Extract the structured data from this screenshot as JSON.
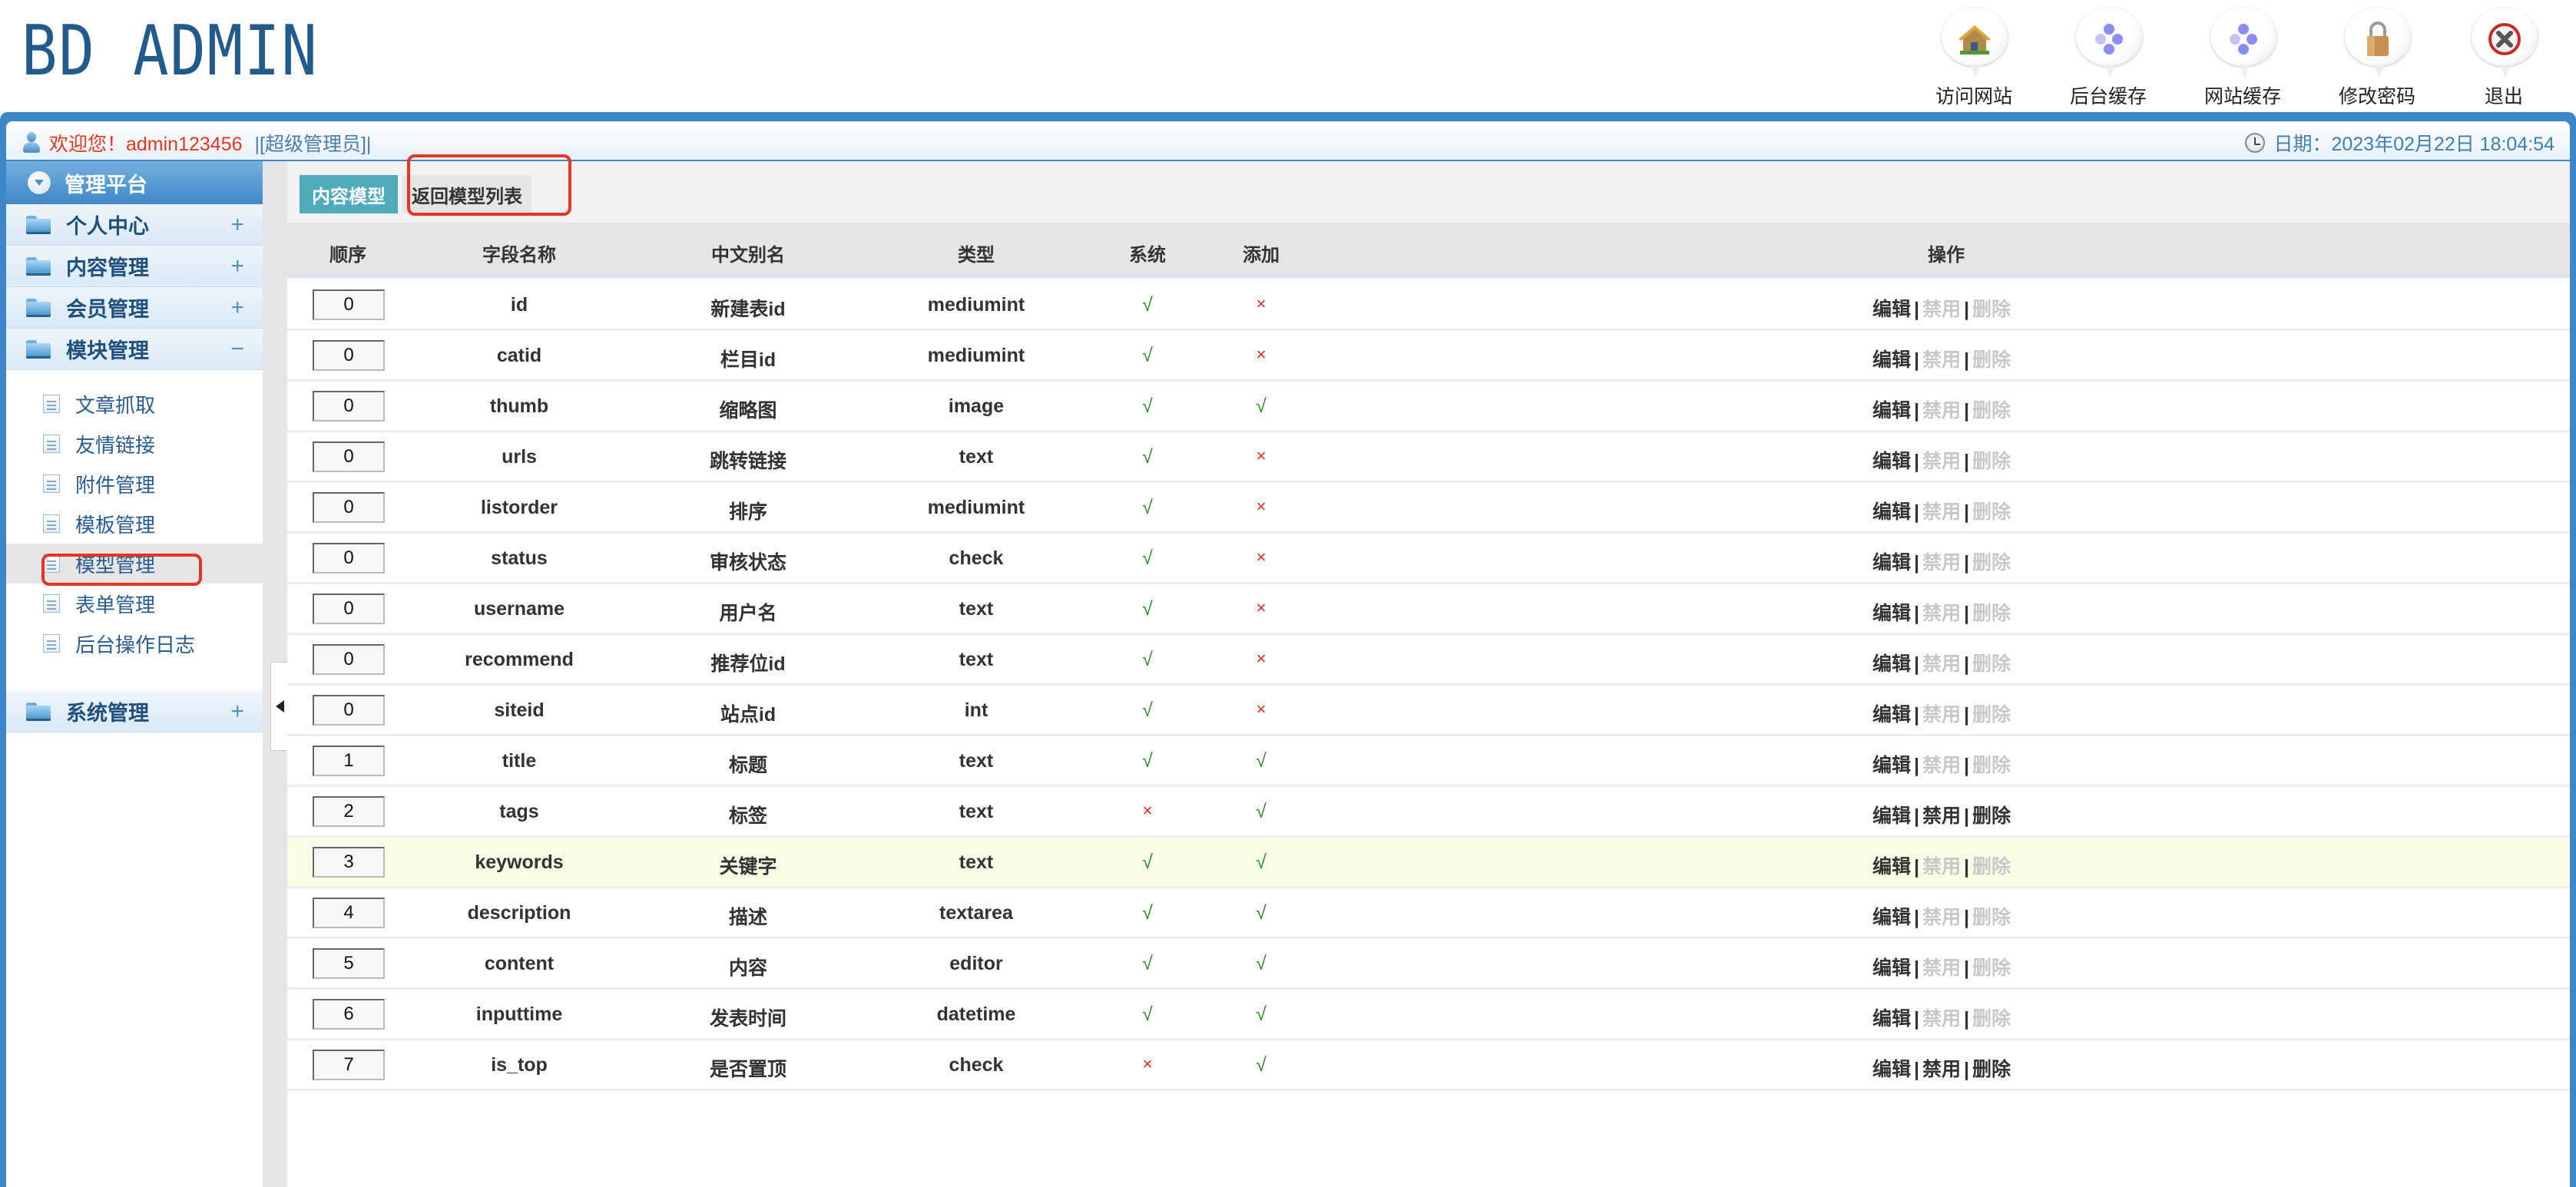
{
  "header": {
    "logo": "BD ADMIN",
    "tools": [
      {
        "label": "访问网站",
        "icon": "house-icon"
      },
      {
        "label": "后台缓存",
        "icon": "cache-icon"
      },
      {
        "label": "网站缓存",
        "icon": "cache-icon"
      },
      {
        "label": "修改密码",
        "icon": "padlock-icon"
      },
      {
        "label": "退出",
        "icon": "logout-icon"
      }
    ]
  },
  "welcome": {
    "greeting": "欢迎您！admin123456",
    "role": "|[超级管理员]|",
    "date": "日期：2023年02月22日 18:04:54"
  },
  "sidebar": {
    "title": "管理平台",
    "groups": [
      {
        "label": "个人中心",
        "toggle": "+"
      },
      {
        "label": "内容管理",
        "toggle": "+"
      },
      {
        "label": "会员管理",
        "toggle": "+"
      },
      {
        "label": "模块管理",
        "toggle": "−"
      },
      {
        "label": "系统管理",
        "toggle": "+"
      }
    ],
    "module_items": [
      {
        "label": "文章抓取"
      },
      {
        "label": "友情链接"
      },
      {
        "label": "附件管理"
      },
      {
        "label": "模板管理"
      },
      {
        "label": "模型管理",
        "active": true
      },
      {
        "label": "表单管理"
      },
      {
        "label": "后台操作日志"
      }
    ]
  },
  "tabs": {
    "current": "内容模型",
    "back": "返回模型列表"
  },
  "table": {
    "headers": [
      "顺序",
      "字段名称",
      "中文别名",
      "类型",
      "系统",
      "添加",
      "操作"
    ],
    "actions": {
      "edit": "编辑",
      "disable": "禁用",
      "delete": "删除",
      "sep": "|"
    },
    "marks": {
      "yes": "√",
      "no": "×"
    },
    "rows": [
      {
        "order": "0",
        "field": "id",
        "alias": "新建表id",
        "type": "mediumint",
        "system": true,
        "add": false,
        "ops_enabled": false
      },
      {
        "order": "0",
        "field": "catid",
        "alias": "栏目id",
        "type": "mediumint",
        "system": true,
        "add": false,
        "ops_enabled": false
      },
      {
        "order": "0",
        "field": "thumb",
        "alias": "缩略图",
        "type": "image",
        "system": true,
        "add": true,
        "ops_enabled": false
      },
      {
        "order": "0",
        "field": "urls",
        "alias": "跳转链接",
        "type": "text",
        "system": true,
        "add": false,
        "ops_enabled": false
      },
      {
        "order": "0",
        "field": "listorder",
        "alias": "排序",
        "type": "mediumint",
        "system": true,
        "add": false,
        "ops_enabled": false
      },
      {
        "order": "0",
        "field": "status",
        "alias": "审核状态",
        "type": "check",
        "system": true,
        "add": false,
        "ops_enabled": false
      },
      {
        "order": "0",
        "field": "username",
        "alias": "用户名",
        "type": "text",
        "system": true,
        "add": false,
        "ops_enabled": false
      },
      {
        "order": "0",
        "field": "recommend",
        "alias": "推荐位id",
        "type": "text",
        "system": true,
        "add": false,
        "ops_enabled": false
      },
      {
        "order": "0",
        "field": "siteid",
        "alias": "站点id",
        "type": "int",
        "system": true,
        "add": false,
        "ops_enabled": false
      },
      {
        "order": "1",
        "field": "title",
        "alias": "标题",
        "type": "text",
        "system": true,
        "add": true,
        "ops_enabled": false
      },
      {
        "order": "2",
        "field": "tags",
        "alias": "标签",
        "type": "text",
        "system": false,
        "add": true,
        "ops_enabled": true
      },
      {
        "order": "3",
        "field": "keywords",
        "alias": "关键字",
        "type": "text",
        "system": true,
        "add": true,
        "ops_enabled": false,
        "highlighted": true
      },
      {
        "order": "4",
        "field": "description",
        "alias": "描述",
        "type": "textarea",
        "system": true,
        "add": true,
        "ops_enabled": false
      },
      {
        "order": "5",
        "field": "content",
        "alias": "内容",
        "type": "editor",
        "system": true,
        "add": true,
        "ops_enabled": false
      },
      {
        "order": "6",
        "field": "inputtime",
        "alias": "发表时间",
        "type": "datetime",
        "system": true,
        "add": true,
        "ops_enabled": false
      },
      {
        "order": "7",
        "field": "is_top",
        "alias": "是否置顶",
        "type": "check",
        "system": false,
        "add": true,
        "ops_enabled": true
      }
    ]
  },
  "colors": {
    "frame_blue": "#3c88c6",
    "tab_active": "#4fabbc",
    "yes_green": "#2b8a25",
    "no_red": "#e2261c",
    "annotation_red": "#e63425",
    "highlight_row": "#fbfce6"
  }
}
